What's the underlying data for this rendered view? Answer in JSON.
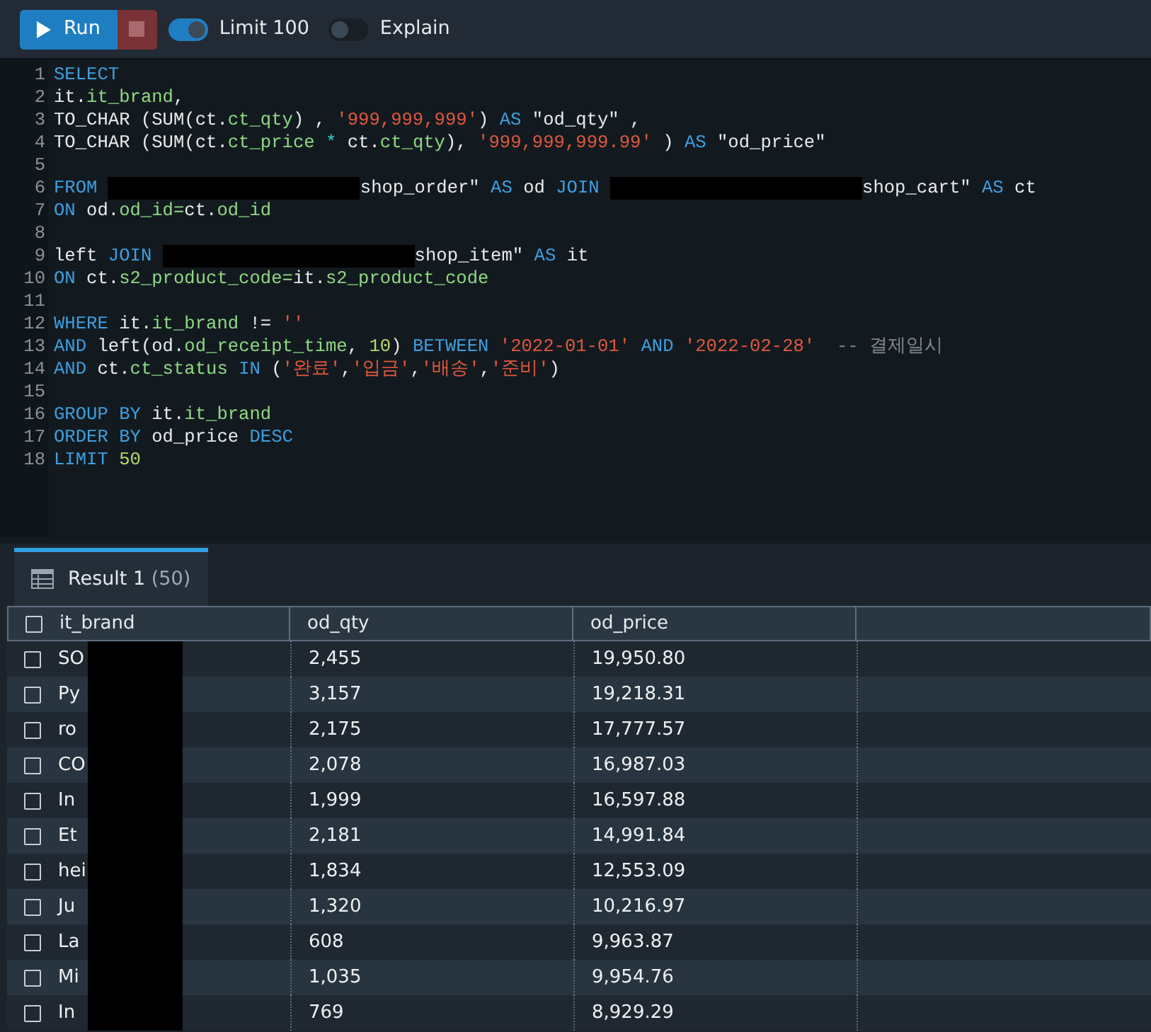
{
  "toolbar": {
    "run_button": "Run",
    "stop_button": {
      "disabled": true
    },
    "toggles": [
      {
        "label": "Limit 100",
        "on": true
      },
      {
        "label": "Explain",
        "on": false
      }
    ]
  },
  "editor": {
    "lines": [
      {
        "number": "1",
        "tokens": [
          {
            "kind": "keyword",
            "text": "SELECT"
          }
        ]
      },
      {
        "number": "2",
        "tokens": [
          {
            "kind": "plain",
            "text": "it."
          },
          {
            "kind": "column",
            "text": "it_brand"
          },
          {
            "kind": "plain",
            "text": ","
          }
        ]
      },
      {
        "number": "3",
        "tokens": [
          {
            "kind": "plain",
            "text": "TO_CHAR (SUM(ct."
          },
          {
            "kind": "column",
            "text": "ct_qty"
          },
          {
            "kind": "plain",
            "text": ") , "
          },
          {
            "kind": "string",
            "text": "'999,999,999'"
          },
          {
            "kind": "plain",
            "text": ") "
          },
          {
            "kind": "keyword",
            "text": "AS"
          },
          {
            "kind": "plain",
            "text": " \"od_qty\" ,"
          }
        ]
      },
      {
        "number": "4",
        "tokens": [
          {
            "kind": "plain",
            "text": "TO_CHAR (SUM(ct."
          },
          {
            "kind": "column",
            "text": "ct_price"
          },
          {
            "kind": "operator",
            "text": " * "
          },
          {
            "kind": "plain",
            "text": "ct."
          },
          {
            "kind": "column",
            "text": "ct_qty"
          },
          {
            "kind": "plain",
            "text": "), "
          },
          {
            "kind": "string",
            "text": "'999,999,999.99'"
          },
          {
            "kind": "plain",
            "text": " ) "
          },
          {
            "kind": "keyword",
            "text": "AS"
          },
          {
            "kind": "plain",
            "text": " \"od_price\""
          }
        ]
      },
      {
        "number": "5"
      },
      {
        "number": "6",
        "tokens": [
          {
            "kind": "keyword",
            "text": "FROM"
          },
          {
            "kind": "redacted"
          },
          {
            "kind": "plain",
            "text": "shop_order\" "
          },
          {
            "kind": "keyword",
            "text": "AS"
          },
          {
            "kind": "plain",
            "text": " od "
          },
          {
            "kind": "keyword",
            "text": "JOIN"
          },
          {
            "kind": "redacted"
          },
          {
            "kind": "plain",
            "text": "shop_cart\" "
          },
          {
            "kind": "keyword",
            "text": "AS"
          },
          {
            "kind": "plain",
            "text": " ct"
          }
        ]
      },
      {
        "number": "7",
        "tokens": [
          {
            "kind": "keyword",
            "text": "ON"
          },
          {
            "kind": "plain",
            "text": " od."
          },
          {
            "kind": "column",
            "text": "od_id="
          },
          {
            "kind": "plain",
            "text": "ct."
          },
          {
            "kind": "column",
            "text": "od_id"
          }
        ]
      },
      {
        "number": "8"
      },
      {
        "number": "9",
        "tokens": [
          {
            "kind": "plain",
            "text": "left "
          },
          {
            "kind": "keyword",
            "text": "JOIN"
          },
          {
            "kind": "redacted"
          },
          {
            "kind": "plain",
            "text": "shop_item\" "
          },
          {
            "kind": "keyword",
            "text": "AS"
          },
          {
            "kind": "plain",
            "text": " it"
          }
        ]
      },
      {
        "number": "10",
        "tokens": [
          {
            "kind": "keyword",
            "text": "ON"
          },
          {
            "kind": "plain",
            "text": " ct."
          },
          {
            "kind": "column",
            "text": "s2_product_code="
          },
          {
            "kind": "plain",
            "text": "it."
          },
          {
            "kind": "column",
            "text": "s2_product_code"
          }
        ]
      },
      {
        "number": "11"
      },
      {
        "number": "12",
        "tokens": [
          {
            "kind": "keyword",
            "text": "WHERE"
          },
          {
            "kind": "plain",
            "text": " it."
          },
          {
            "kind": "column",
            "text": "it_brand"
          },
          {
            "kind": "plain",
            "text": " != "
          },
          {
            "kind": "string",
            "text": "''"
          }
        ]
      },
      {
        "number": "13",
        "tokens": [
          {
            "kind": "keyword",
            "text": "AND"
          },
          {
            "kind": "plain",
            "text": " left(od."
          },
          {
            "kind": "column",
            "text": "od_receipt_time"
          },
          {
            "kind": "plain",
            "text": ", "
          },
          {
            "kind": "number",
            "text": "10"
          },
          {
            "kind": "plain",
            "text": ") "
          },
          {
            "kind": "keyword",
            "text": "BETWEEN "
          },
          {
            "kind": "string",
            "text": "'2022-01-01'"
          },
          {
            "kind": "keyword",
            "text": " AND "
          },
          {
            "kind": "string",
            "text": "'2022-02-28'"
          },
          {
            "kind": "comment",
            "text": "  -- 결제일시"
          }
        ]
      },
      {
        "number": "14",
        "tokens": [
          {
            "kind": "keyword",
            "text": "AND"
          },
          {
            "kind": "plain",
            "text": " ct."
          },
          {
            "kind": "column",
            "text": "ct_status"
          },
          {
            "kind": "keyword",
            "text": " IN"
          },
          {
            "kind": "plain",
            "text": " ("
          },
          {
            "kind": "string",
            "text": "'완료'"
          },
          {
            "kind": "plain",
            "text": ","
          },
          {
            "kind": "string",
            "text": "'입금'"
          },
          {
            "kind": "plain",
            "text": ","
          },
          {
            "kind": "string",
            "text": "'배송'"
          },
          {
            "kind": "plain",
            "text": ","
          },
          {
            "kind": "string",
            "text": "'준비'"
          },
          {
            "kind": "plain",
            "text": ")"
          }
        ]
      },
      {
        "number": "15"
      },
      {
        "number": "16",
        "tokens": [
          {
            "kind": "keyword",
            "text": "GROUP BY"
          },
          {
            "kind": "plain",
            "text": " it."
          },
          {
            "kind": "column",
            "text": "it_brand"
          }
        ]
      },
      {
        "number": "17",
        "tokens": [
          {
            "kind": "keyword",
            "text": "ORDER BY"
          },
          {
            "kind": "plain",
            "text": " od_price "
          },
          {
            "kind": "keyword",
            "text": "DESC"
          }
        ]
      },
      {
        "number": "18",
        "tokens": [
          {
            "kind": "keyword",
            "text": "LIMIT "
          },
          {
            "kind": "number",
            "text": "50"
          }
        ]
      }
    ]
  },
  "result_tabs": [
    {
      "label": "Result 1",
      "count": "(50)",
      "selected": true
    }
  ],
  "table": {
    "header_checked": false,
    "columns": [
      "it_brand",
      "od_qty",
      "od_price"
    ],
    "rows": [
      {
        "checked": false,
        "redacted": true,
        "cells": [
          "SO",
          "2,455",
          "19,950.80"
        ]
      },
      {
        "checked": false,
        "redacted": true,
        "cells": [
          "Py",
          "3,157",
          "19,218.31"
        ]
      },
      {
        "checked": false,
        "redacted": true,
        "cells": [
          "ro",
          "2,175",
          "17,777.57"
        ]
      },
      {
        "checked": false,
        "redacted": true,
        "cells": [
          "CO",
          "2,078",
          "16,987.03"
        ]
      },
      {
        "checked": false,
        "redacted": true,
        "cells": [
          "In",
          "1,999",
          "16,597.88"
        ]
      },
      {
        "checked": false,
        "redacted": true,
        "cells": [
          "Et",
          "2,181",
          "14,991.84"
        ]
      },
      {
        "checked": false,
        "redacted": true,
        "cells": [
          "hei",
          "1,834",
          "12,553.09"
        ]
      },
      {
        "checked": false,
        "redacted": true,
        "cells": [
          "Ju",
          "1,320",
          "10,216.97"
        ]
      },
      {
        "checked": false,
        "redacted": true,
        "cells": [
          "La",
          "608",
          "9,963.87"
        ]
      },
      {
        "checked": false,
        "redacted": true,
        "cells": [
          "Mi",
          "1,035",
          "9,954.76"
        ]
      },
      {
        "checked": false,
        "redacted": true,
        "cells": [
          "In",
          "769",
          "8,929.29"
        ]
      }
    ]
  }
}
